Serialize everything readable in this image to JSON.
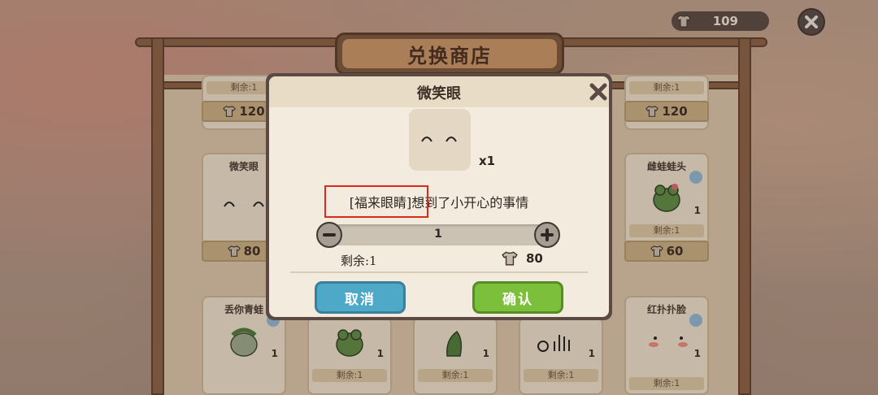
{
  "currency": {
    "amount": "109",
    "icon": "shirt-icon"
  },
  "shop": {
    "title": "兑换商店",
    "cards": [
      {
        "id": "c1",
        "remain": "剩余:1",
        "price": "120"
      },
      {
        "id": "c2",
        "remain": "剩余:1",
        "price": "120"
      },
      {
        "id": "c3",
        "name": "微笑眼",
        "price": "80"
      },
      {
        "id": "c4",
        "name": "雌蛙蛙头",
        "remain": "剩余:1",
        "qty": "1",
        "price": "60"
      },
      {
        "id": "c5",
        "name": "丢你青蛙",
        "qty": "1"
      },
      {
        "id": "c6",
        "remain": "剩余:1",
        "qty": "1"
      },
      {
        "id": "c7",
        "remain": "剩余:1",
        "qty": "1"
      },
      {
        "id": "c8",
        "remain": "剩余:1",
        "qty": "1"
      },
      {
        "id": "c9",
        "name": "红扑扑脸",
        "remain": "剩余:1",
        "qty": "1"
      }
    ]
  },
  "dialog": {
    "title": "微笑眼",
    "item_count": "x1",
    "description": "[福来眼睛]想到了小开心的事情",
    "quantity": "1",
    "remain": "剩余:1",
    "cost": "80",
    "cancel_label": "取消",
    "confirm_label": "确认"
  },
  "colors": {
    "cancel": "#4ea9c9",
    "confirm": "#7bbf3a",
    "highlight": "#d62b1e"
  }
}
